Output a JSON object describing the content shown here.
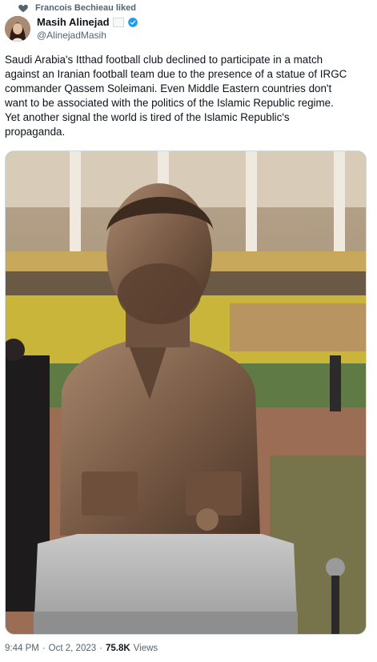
{
  "social_context": {
    "text": "Francois Bechieau liked"
  },
  "author": {
    "name": "Masih Alinejad",
    "handle": "@AlinejadMasih"
  },
  "tweet": {
    "text": "Saudi Arabia's Itthad football club declined to participate in a match\nagainst an Iranian football team due to the presence of a statue of IRGC\ncommander Qassem Soleimani. Even Middle Eastern countries don't\nwant to be associated with the politics of the Islamic Republic regime.\nYet another signal the world is tired of the Islamic Republic's\npropaganda."
  },
  "media": {
    "icon": "bronze-bust-photo"
  },
  "meta": {
    "time": "9:44 PM",
    "separator": "·",
    "date": "Oct 2, 2023",
    "separator2": "·",
    "views_count": "75.8K",
    "views_label": "Views"
  },
  "colors": {
    "text": "#0f1419",
    "secondary": "#536471",
    "verified": "#1d9bf0"
  }
}
